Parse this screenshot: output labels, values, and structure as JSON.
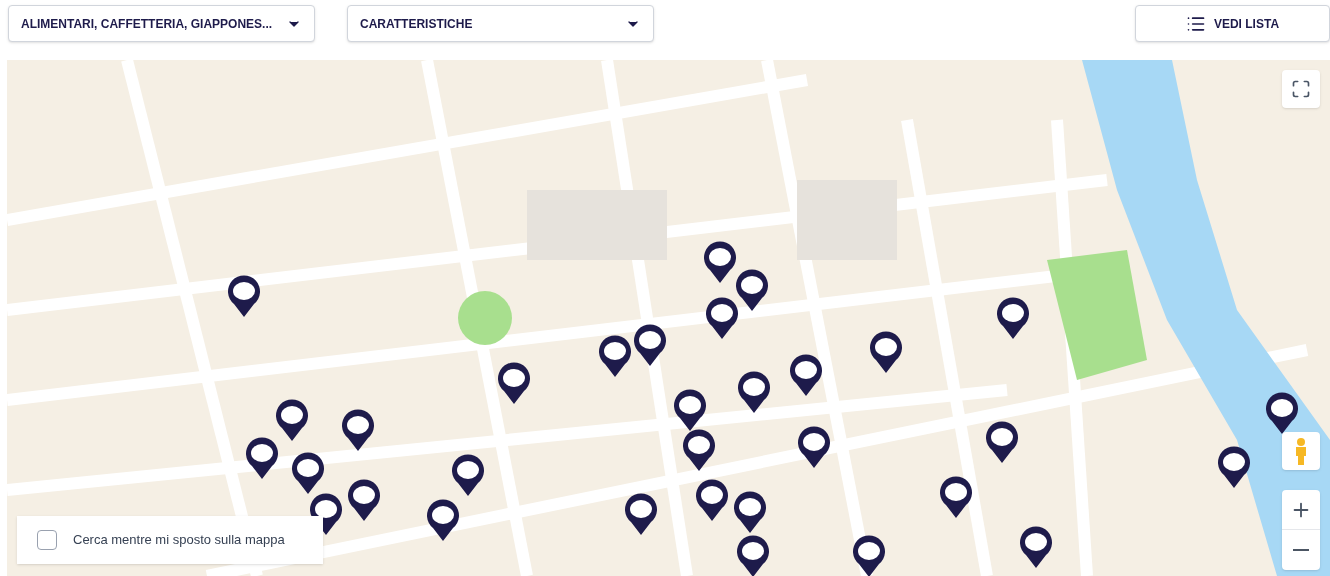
{
  "filters": [
    {
      "label": "ALIMENTARI, CAFFETTERIA, GIAPPONES..."
    },
    {
      "label": "CARATTERISTICHE"
    }
  ],
  "list_button": {
    "label": "VEDI LISTA"
  },
  "map": {
    "search_on_move": {
      "label": "Cerca mentre mi sposto sulla mappa",
      "checked": false
    }
  }
}
